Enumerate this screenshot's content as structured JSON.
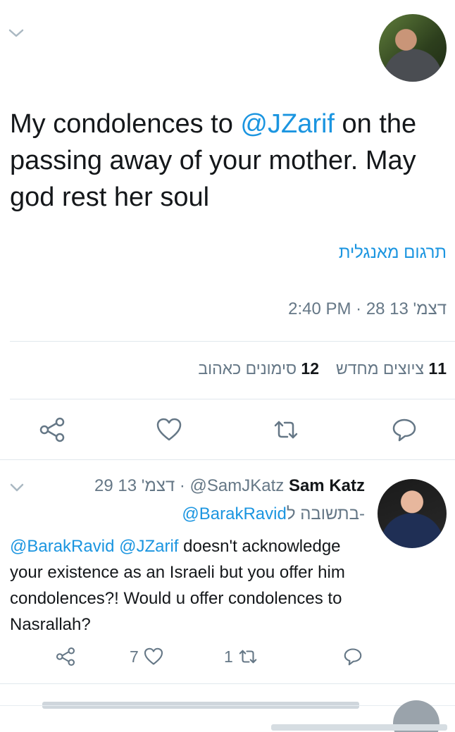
{
  "tweet": {
    "text_before": "My condolences to ",
    "mention": "@JZarif",
    "text_after": " on the passing away of your mother. May god rest her soul",
    "translate_label": "תרגום מאנגלית",
    "timestamp": "2:40 PM · 28 13 'דצמ",
    "stats": {
      "retweets_count": "11",
      "retweets_label": "ציוצים מחדש",
      "likes_count": "12",
      "likes_label": "סימונים כאהוב"
    }
  },
  "reply": {
    "name": "Sam Katz",
    "handle": "@SamJKatz",
    "date": "29 13 'דצמ",
    "separator": " · ",
    "replying_to_label": "בתשובה ל-",
    "replying_to_handle": "@BarakRavid",
    "mentions": "@BarakRavid @JZarif",
    "text": " doesn't acknowledge your existence as an Israeli but you offer him condolences?! Would u offer condolences to Nasrallah?",
    "like_count": "7",
    "retweet_count": "1"
  },
  "colors": {
    "link": "#1b95e0",
    "secondary": "#657786",
    "divider": "#e1e8ed"
  },
  "icons": [
    "chevron-down-icon",
    "share-icon",
    "heart-icon",
    "retweet-icon",
    "reply-icon"
  ]
}
